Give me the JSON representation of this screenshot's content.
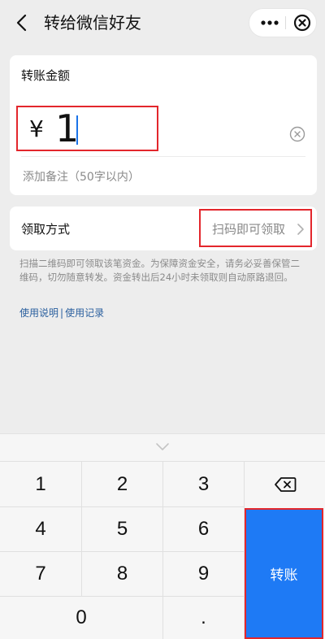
{
  "header": {
    "title": "转给微信好友"
  },
  "amount": {
    "label": "转账金额",
    "currency": "¥",
    "value": "1",
    "note_placeholder": "添加备注（50字以内）"
  },
  "method": {
    "label": "领取方式",
    "value": "扫码即可领取"
  },
  "description": "扫描二维码即可领取该笔资金。为保障资金安全，请务必妥善保管二维码，切勿随意转发。资金转出后24小时未领取则自动原路退回。",
  "links": {
    "help": "使用说明",
    "separator": "|",
    "history": "使用记录"
  },
  "keypad": {
    "keys": [
      "1",
      "2",
      "3",
      "4",
      "5",
      "6",
      "7",
      "8",
      "9",
      "0",
      "."
    ],
    "transfer_label": "转账"
  },
  "colors": {
    "accent": "#1e7af5",
    "highlight_border": "#e3262c",
    "link": "#2a5f9e"
  },
  "icons": [
    "back-icon",
    "more-icon",
    "close-icon",
    "clear-icon",
    "chevron-right-icon",
    "chevron-down-icon",
    "backspace-icon"
  ]
}
